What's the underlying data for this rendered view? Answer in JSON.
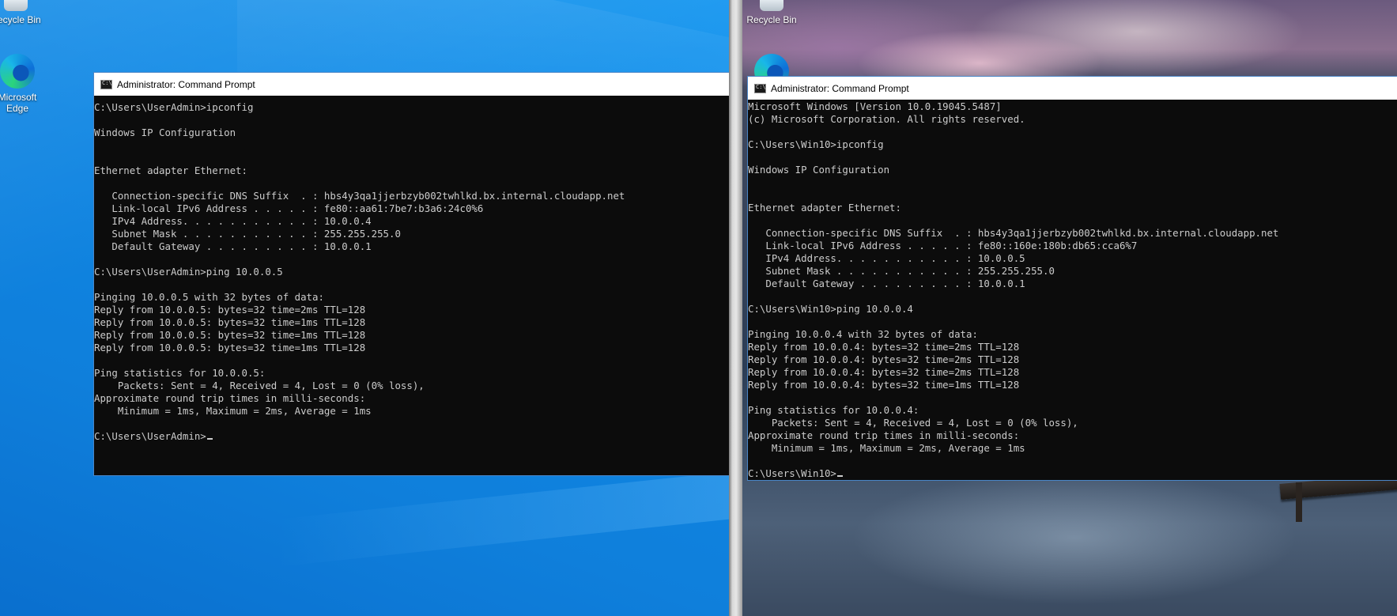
{
  "left_vm": {
    "desktop_icons": [
      {
        "label": "Recycle Bin",
        "icon": "recycle-bin-icon"
      },
      {
        "label": "Microsoft Edge",
        "icon": "edge-icon"
      }
    ],
    "window": {
      "title": "Administrator: Command Prompt",
      "lines": [
        "C:\\Users\\UserAdmin>ipconfig",
        "",
        "Windows IP Configuration",
        "",
        "",
        "Ethernet adapter Ethernet:",
        "",
        "   Connection-specific DNS Suffix  . : hbs4y3qa1jjerbzyb002twhlkd.bx.internal.cloudapp.net",
        "   Link-local IPv6 Address . . . . . : fe80::aa61:7be7:b3a6:24c0%6",
        "   IPv4 Address. . . . . . . . . . . : 10.0.0.4",
        "   Subnet Mask . . . . . . . . . . . : 255.255.255.0",
        "   Default Gateway . . . . . . . . . : 10.0.0.1",
        "",
        "C:\\Users\\UserAdmin>ping 10.0.0.5",
        "",
        "Pinging 10.0.0.5 with 32 bytes of data:",
        "Reply from 10.0.0.5: bytes=32 time=2ms TTL=128",
        "Reply from 10.0.0.5: bytes=32 time=1ms TTL=128",
        "Reply from 10.0.0.5: bytes=32 time=1ms TTL=128",
        "Reply from 10.0.0.5: bytes=32 time=1ms TTL=128",
        "",
        "Ping statistics for 10.0.0.5:",
        "    Packets: Sent = 4, Received = 4, Lost = 0 (0% loss),",
        "Approximate round trip times in milli-seconds:",
        "    Minimum = 1ms, Maximum = 2ms, Average = 1ms",
        ""
      ],
      "prompt": "C:\\Users\\UserAdmin>"
    }
  },
  "right_vm": {
    "desktop_icons": [
      {
        "label": "Recycle Bin",
        "icon": "recycle-bin-icon"
      }
    ],
    "window": {
      "title": "Administrator: Command Prompt",
      "lines": [
        "Microsoft Windows [Version 10.0.19045.5487]",
        "(c) Microsoft Corporation. All rights reserved.",
        "",
        "C:\\Users\\Win10>ipconfig",
        "",
        "Windows IP Configuration",
        "",
        "",
        "Ethernet adapter Ethernet:",
        "",
        "   Connection-specific DNS Suffix  . : hbs4y3qa1jjerbzyb002twhlkd.bx.internal.cloudapp.net",
        "   Link-local IPv6 Address . . . . . : fe80::160e:180b:db65:cca6%7",
        "   IPv4 Address. . . . . . . . . . . : 10.0.0.5",
        "   Subnet Mask . . . . . . . . . . . : 255.255.255.0",
        "   Default Gateway . . . . . . . . . : 10.0.0.1",
        "",
        "C:\\Users\\Win10>ping 10.0.0.4",
        "",
        "Pinging 10.0.0.4 with 32 bytes of data:",
        "Reply from 10.0.0.4: bytes=32 time=2ms TTL=128",
        "Reply from 10.0.0.4: bytes=32 time=2ms TTL=128",
        "Reply from 10.0.0.4: bytes=32 time=2ms TTL=128",
        "Reply from 10.0.0.4: bytes=32 time=1ms TTL=128",
        "",
        "Ping statistics for 10.0.0.4:",
        "    Packets: Sent = 4, Received = 4, Lost = 0 (0% loss),",
        "Approximate round trip times in milli-seconds:",
        "    Minimum = 1ms, Maximum = 2ms, Average = 1ms",
        ""
      ],
      "prompt": "C:\\Users\\Win10>"
    }
  },
  "colors": {
    "left_wallpaper": "#0f86e3",
    "console_bg": "#0c0c0c",
    "console_text": "#cccccc",
    "titlebar_bg": "#ffffff"
  }
}
